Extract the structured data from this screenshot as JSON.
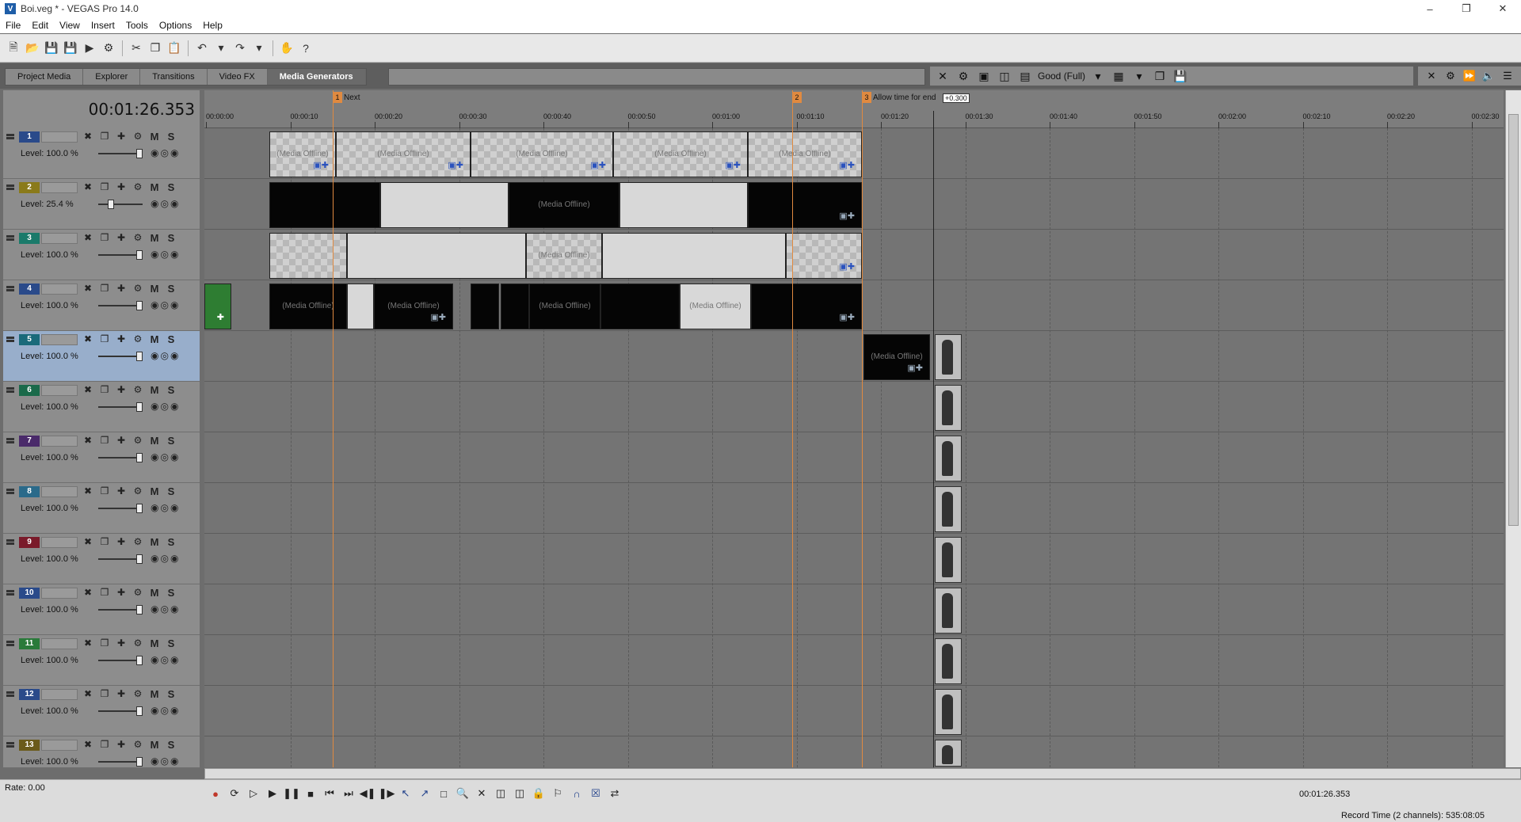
{
  "window": {
    "title": "Boi.veg * - VEGAS Pro 14.0",
    "app_icon": "vegas-icon",
    "controls": [
      "minimize",
      "restore",
      "close"
    ]
  },
  "menu": [
    "File",
    "Edit",
    "View",
    "Insert",
    "Tools",
    "Options",
    "Help"
  ],
  "toolbar_icons": [
    "new-icon",
    "open-icon",
    "save-icon",
    "save-as-icon",
    "render-icon",
    "properties-icon",
    "cut-icon",
    "copy-icon",
    "paste-icon",
    "undo-icon",
    "redo-icon",
    "hand-icon",
    "help-icon"
  ],
  "tabs": [
    {
      "label": "Project Media",
      "active": false
    },
    {
      "label": "Explorer",
      "active": false
    },
    {
      "label": "Transitions",
      "active": false
    },
    {
      "label": "Video FX",
      "active": false
    },
    {
      "label": "Media Generators",
      "active": true
    }
  ],
  "preview": {
    "quality": "Good (Full)"
  },
  "timecode": "00:01:26.353",
  "markers": [
    {
      "num": "1",
      "label": "Next"
    },
    {
      "num": "2",
      "label": ""
    },
    {
      "num": "3",
      "label": "Allow time for end"
    }
  ],
  "cursor_tag": "+0.300",
  "ruler_labels": [
    "00:00:00",
    "00:00:10",
    "00:00:20",
    "00:00:30",
    "00:00:40",
    "00:00:50",
    "00:01:00",
    "00:01:10",
    "00:01:20",
    "00:01:30",
    "00:01:40",
    "00:01:50",
    "00:02:00",
    "00:02:10",
    "00:02:20",
    "00:02:30"
  ],
  "tracks": [
    {
      "num": "1",
      "color": "#2a4a8a",
      "level": "Level: 100.0 %",
      "level_value": 100.0
    },
    {
      "num": "2",
      "color": "#8a7a1a",
      "level": "Level:  25.4 %",
      "level_value": 25.4
    },
    {
      "num": "3",
      "color": "#1a7a6a",
      "level": "Level: 100.0 %",
      "level_value": 100.0
    },
    {
      "num": "4",
      "color": "#2a4a8a",
      "level": "Level: 100.0 %",
      "level_value": 100.0
    },
    {
      "num": "5",
      "color": "#1a6a7a",
      "level": "Level: 100.0 %",
      "level_value": 100.0,
      "selected": true
    },
    {
      "num": "6",
      "color": "#1a6a4a",
      "level": "Level: 100.0 %",
      "level_value": 100.0
    },
    {
      "num": "7",
      "color": "#4a2a6a",
      "level": "Level: 100.0 %",
      "level_value": 100.0
    },
    {
      "num": "8",
      "color": "#2a6a8a",
      "level": "Level: 100.0 %",
      "level_value": 100.0
    },
    {
      "num": "9",
      "color": "#7a1a2a",
      "level": "Level: 100.0 %",
      "level_value": 100.0
    },
    {
      "num": "10",
      "color": "#2a4a8a",
      "level": "Level: 100.0 %",
      "level_value": 100.0
    },
    {
      "num": "11",
      "color": "#2a7a3a",
      "level": "Level: 100.0 %",
      "level_value": 100.0
    },
    {
      "num": "12",
      "color": "#2a4a8a",
      "level": "Level: 100.0 %",
      "level_value": 100.0
    },
    {
      "num": "13",
      "color": "#6a5a1a",
      "level": "Level: 100.0 %",
      "level_value": 100.0
    }
  ],
  "track_buttons": {
    "mute": "M",
    "solo": "S"
  },
  "media_offline": "(Media Offline)",
  "rate": "Rate: 0.00",
  "status_time": "00:01:26.353",
  "record_time": "Record Time (2 channels): 535:08:05"
}
